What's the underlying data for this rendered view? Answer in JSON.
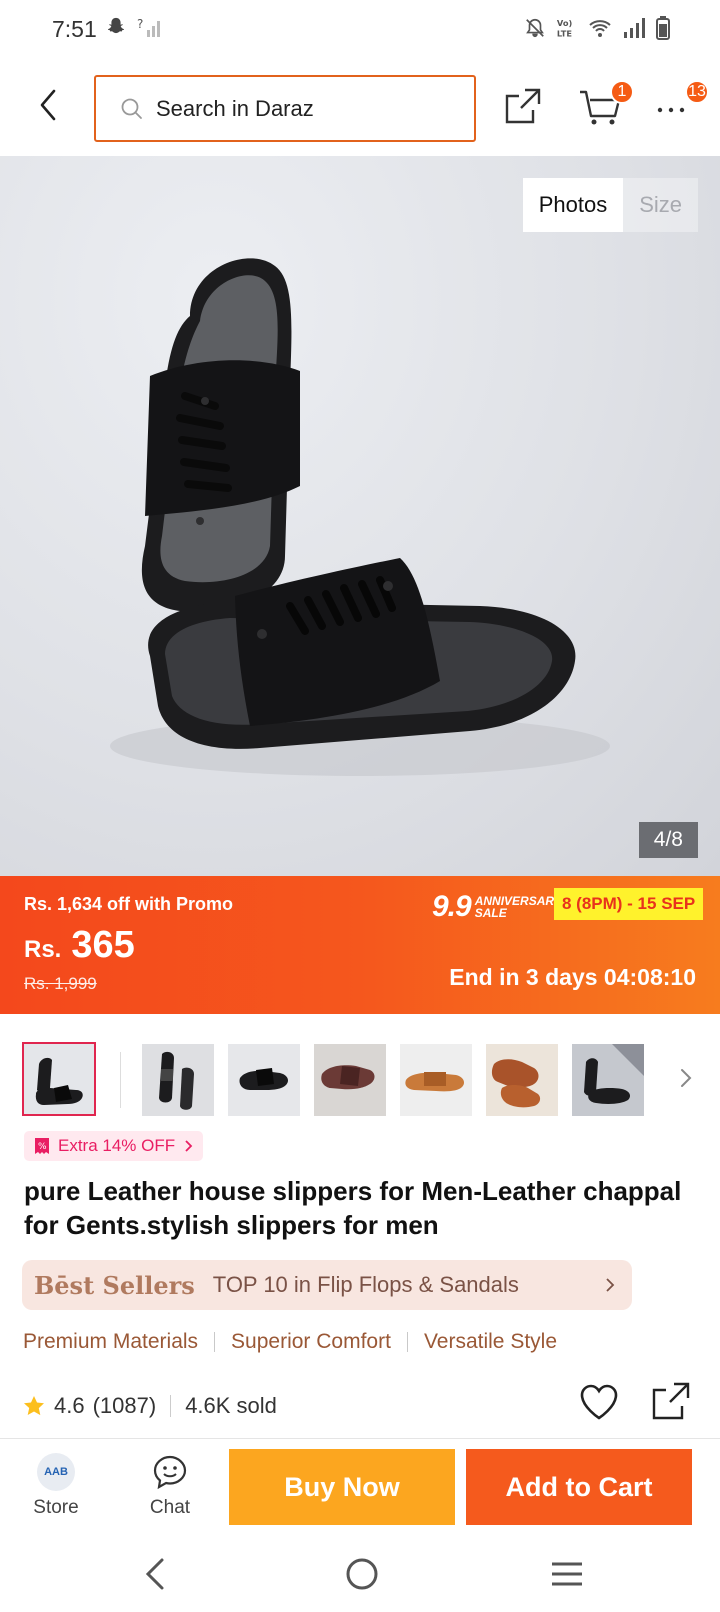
{
  "status_bar": {
    "time": "7:51",
    "icons": [
      "snapchat-icon",
      "no-signal-icon",
      "mute-icon",
      "volte-icon",
      "wifi-icon",
      "signal-icon",
      "battery-icon"
    ],
    "volte_label": "Vo) LTE"
  },
  "header": {
    "search_placeholder": "Search in Daraz",
    "cart_count": "1",
    "notifications_count": "13",
    "accent_color": "#e2621c"
  },
  "gallery": {
    "tabs": [
      "Photos",
      "Size"
    ],
    "active_tab": "Photos",
    "counter": "4/8"
  },
  "price": {
    "promo_text": "Rs. 1,634 off with Promo",
    "currency": "Rs.",
    "value": "365",
    "original": "Rs. 1,999",
    "sale_big": "9.9",
    "sale_small": "Anniversary Sale",
    "sale_dates": "8 (8PM) - 15 SEP",
    "countdown": "End in 3 days 04:08:10"
  },
  "thumbnails": {
    "count": 7,
    "selected_index": 0
  },
  "product": {
    "extra_discount": "Extra 14% OFF",
    "title": "pure Leather house slippers for Men-Leather chappal for Gents.stylish slippers for men",
    "best_sellers_label": "Bēst Sellers",
    "best_sellers_text": "TOP 10 in Flip Flops & Sandals",
    "features": [
      "Premium Materials",
      "Superior Comfort",
      "Versatile Style"
    ],
    "rating": "4.6",
    "reviews": "(1087)",
    "sold": "4.6K sold"
  },
  "action_bar": {
    "store_label": "Store",
    "store_logo_text": "AAB",
    "chat_label": "Chat",
    "buy_now_label": "Buy Now",
    "add_to_cart_label": "Add to Cart",
    "buy_now_color": "#fca61f",
    "add_to_cart_color": "#f55a1d"
  }
}
